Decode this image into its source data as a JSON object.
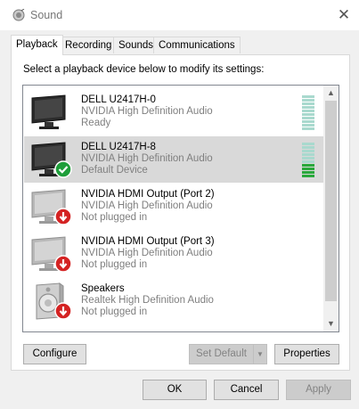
{
  "window": {
    "title": "Sound",
    "icon": "speaker-icon"
  },
  "tabs": [
    {
      "label": "Playback"
    },
    {
      "label": "Recording"
    },
    {
      "label": "Sounds"
    },
    {
      "label": "Communications"
    }
  ],
  "active_tab": "Playback",
  "instructions": "Select a playback device below to modify its settings:",
  "devices": [
    {
      "name": "DELL U2417H-0",
      "driver": "NVIDIA High Definition Audio",
      "status": "Ready",
      "icon": "monitor-icon",
      "level": 0
    },
    {
      "name": "DELL U2417H-8",
      "driver": "NVIDIA High Definition Audio",
      "status": "Default Device",
      "icon": "monitor-icon",
      "badge": "default-check-icon",
      "level": 0.4
    },
    {
      "name": "NVIDIA HDMI Output (Port 2)",
      "driver": "NVIDIA High Definition Audio",
      "status": "Not plugged in",
      "icon": "monitor-icon",
      "badge": "unplugged-arrow-icon"
    },
    {
      "name": "NVIDIA HDMI Output (Port 3)",
      "driver": "NVIDIA High Definition Audio",
      "status": "Not plugged in",
      "icon": "monitor-icon",
      "badge": "unplugged-arrow-icon"
    },
    {
      "name": "Speakers",
      "driver": "Realtek High Definition Audio",
      "status": "Not plugged in",
      "icon": "speaker-icon",
      "badge": "unplugged-arrow-icon"
    }
  ],
  "selected_device": "DELL U2417H-8",
  "buttons": {
    "configure": "Configure",
    "set_default": "Set Default",
    "properties": "Properties",
    "ok": "OK",
    "cancel": "Cancel",
    "apply": "Apply"
  },
  "colors": {
    "selection": "#d9d9d9",
    "meter_on": "#2aa83c",
    "meter_off": "#a9d9ce",
    "default_badge": "#1e9e3a",
    "unplugged_badge": "#d42323"
  }
}
